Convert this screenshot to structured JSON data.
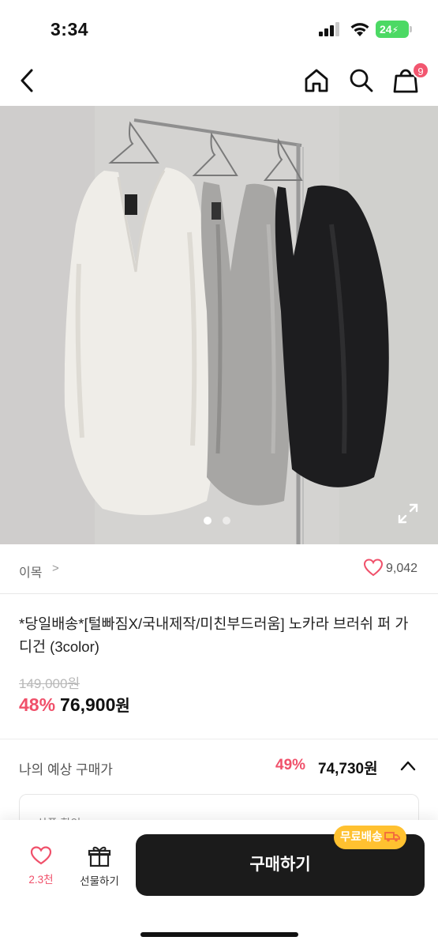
{
  "status_bar": {
    "time": "3:34",
    "battery": "24"
  },
  "header": {
    "back_icon": "chevron-left-icon",
    "home_icon": "home-icon",
    "search_icon": "search-icon",
    "cart_icon": "shopping-bag-icon",
    "cart_count": "9"
  },
  "gallery": {
    "image_description_icon": "product-photo",
    "active_index": 1,
    "total": 2,
    "expand_icon": "expand-icon"
  },
  "brand": {
    "name": "이목",
    "arrow": ">",
    "like_count": "9,042"
  },
  "product": {
    "title": "*당일배송*[털빠짐X/국내제작/미친부드러움]  노카라 브러쉬 퍼 가디건 (3color)",
    "original_price": "149,000원",
    "discount": "48%",
    "price": "76,900",
    "currency": "원"
  },
  "expected": {
    "label": "나의 예상 구매가",
    "discount": "49%",
    "price": "74,730원",
    "coupon_label": "상품 할인"
  },
  "bottom_bar": {
    "wish_count": "2.3천",
    "gift_label": "선물하기",
    "buy_label": "구매하기",
    "free_shipping_label": "무료배송"
  },
  "colors": {
    "accent": "#f0506a",
    "buy_button": "#1b1b1b",
    "free_shipping_badge": "#ffc130"
  }
}
